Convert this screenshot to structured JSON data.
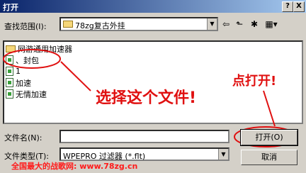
{
  "window": {
    "title": "打开",
    "help_button": "?",
    "close_button": "X"
  },
  "lookin": {
    "label": "查找范围(I):",
    "value": "78zg复古外挂"
  },
  "files": [
    {
      "name": "网游通用加速器",
      "type": "folder"
    },
    {
      "name": "、封包",
      "type": "file"
    },
    {
      "name": "1",
      "type": "file"
    },
    {
      "name": "加速",
      "type": "file"
    },
    {
      "name": "无情加速",
      "type": "file"
    }
  ],
  "filename": {
    "label": "文件名(N):",
    "value": ""
  },
  "filetype": {
    "label": "文件类型(T):",
    "value": "WPEPRO 过滤器 (*.flt)"
  },
  "buttons": {
    "open": "打开(O)",
    "cancel": "取消"
  },
  "annotations": {
    "select_file": "选择这个文件!",
    "click_open": "点打开!"
  },
  "watermark": "全国最大的战歌网: www.78zg.cn",
  "colors": {
    "annotation": "#e01010",
    "titlebar": "#0a246a"
  }
}
